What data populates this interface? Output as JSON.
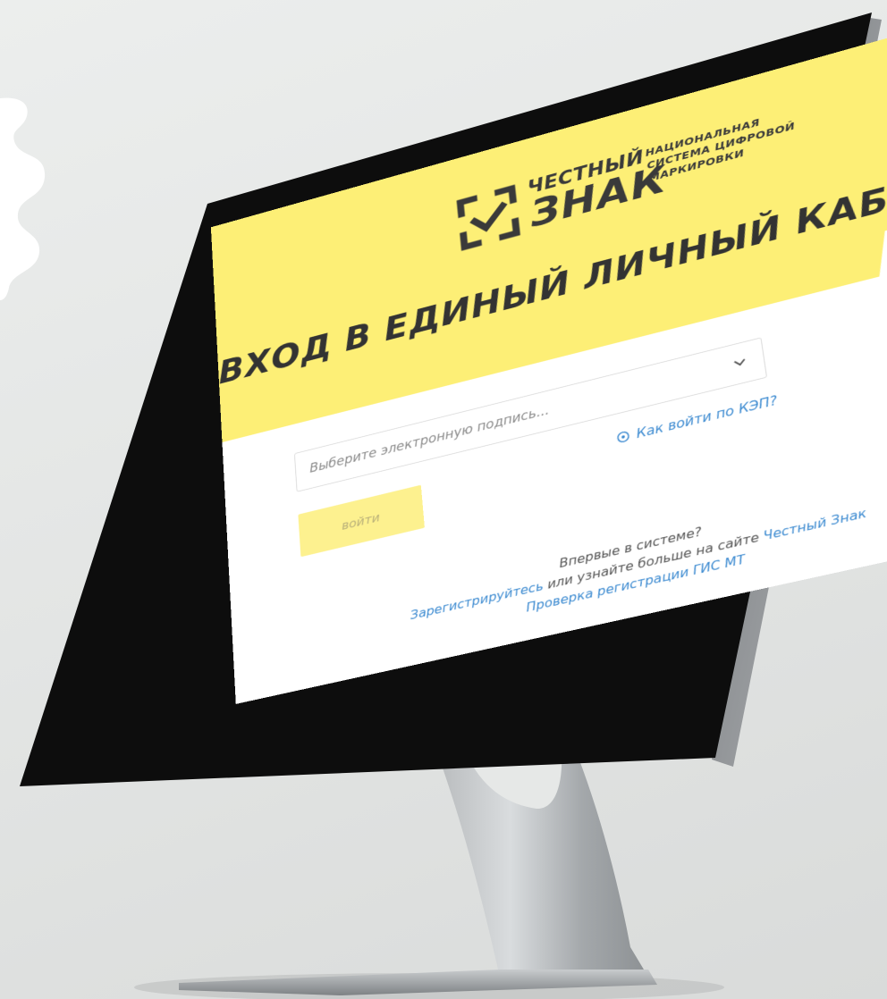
{
  "logo": {
    "word1": "ЧЕСТНЫЙ",
    "word2": "ЗНАК",
    "tagline": [
      "НАЦИОНАЛЬНАЯ",
      "СИСТЕМА ЦИФРОВОЙ",
      "МАРКИРОВКИ"
    ]
  },
  "page": {
    "title": "ВХОД В ЕДИНЫЙ ЛИЧНЫЙ КАБИНЕТ"
  },
  "signature_select": {
    "placeholder": "Выберите электронную подпись..."
  },
  "help": {
    "label": "Как войти по КЭП?"
  },
  "login_button": {
    "label": "войти"
  },
  "footer": {
    "question": "Впервые в системе?",
    "register_link": "Зарегистрируйтесь",
    "middle_text": " или узнайте больше на сайте ",
    "site_link": "Честный Знак",
    "check_link": "Проверка регистрации ГИС МТ"
  },
  "colors": {
    "brand_yellow": "#fdef76",
    "button_yellow": "#fdf18f",
    "link_blue": "#3d8bd1",
    "text_dark": "#333333"
  },
  "icons": [
    "logo-mark-icon",
    "chevron-down-icon",
    "help-circle-icon",
    "webcam-icon"
  ]
}
